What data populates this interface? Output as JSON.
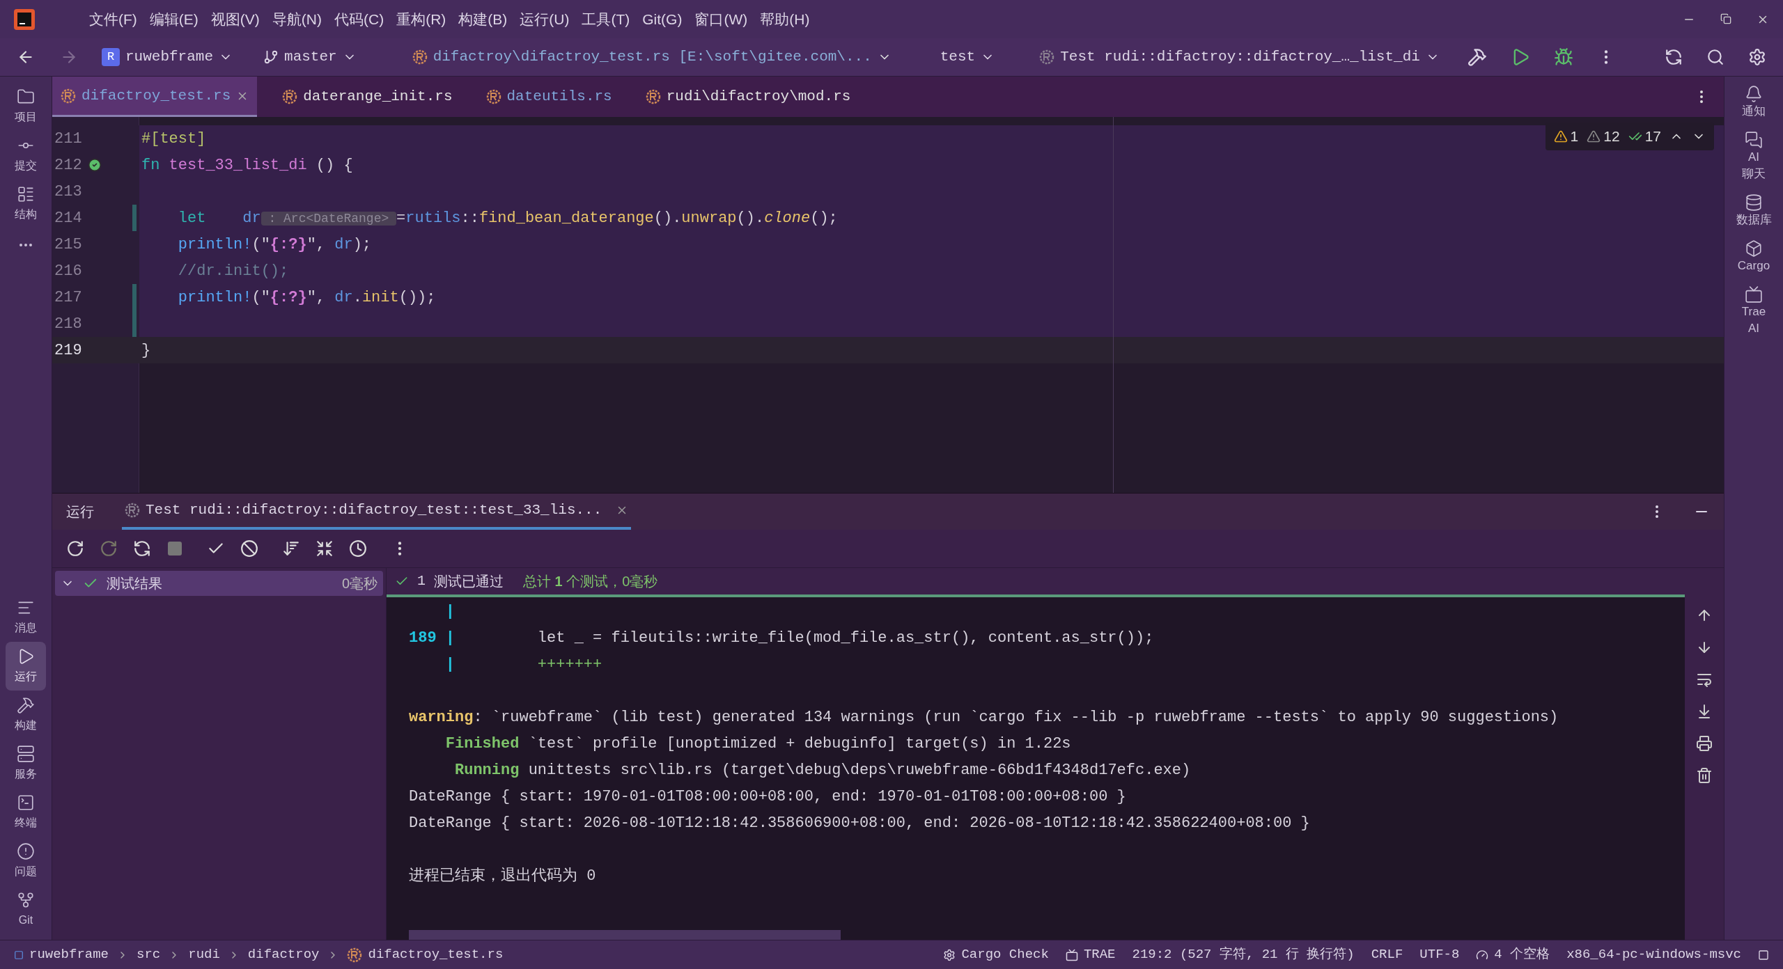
{
  "menu": [
    "文件(F)",
    "编辑(E)",
    "视图(V)",
    "导航(N)",
    "代码(C)",
    "重构(R)",
    "构建(B)",
    "运行(U)",
    "工具(T)",
    "Git(G)",
    "窗口(W)",
    "帮助(H)"
  ],
  "toolbar": {
    "project_badge": "R",
    "project": "ruwebframe",
    "branch": "master",
    "file": "difactroy\\difactroy_test.rs [E:\\soft\\gitee.com\\...",
    "profile": "test",
    "run_config": "Test rudi::difactroy::difactroy_…_list_di"
  },
  "tabs": [
    {
      "label": "difactroy_test.rs",
      "selected": true,
      "color": "#7fa6d9"
    },
    {
      "label": "daterange_init.rs",
      "selected": false,
      "color": "#e2e2e2"
    },
    {
      "label": "dateutils.rs",
      "selected": false,
      "color": "#7fa6d9"
    },
    {
      "label": "rudi\\difactroy\\mod.rs",
      "selected": false,
      "color": "#e2e2e2"
    }
  ],
  "left_tools_top": [
    {
      "label": "项目",
      "selected": false
    },
    {
      "label": "提交",
      "selected": false
    },
    {
      "label": "结构",
      "selected": false
    }
  ],
  "left_tools_bottom": [
    {
      "label": "消息",
      "selected": false
    },
    {
      "label": "运行",
      "selected": true
    },
    {
      "label": "构建",
      "selected": false
    },
    {
      "label": "服务",
      "selected": false
    },
    {
      "label": "终端",
      "selected": false
    },
    {
      "label": "问题",
      "selected": false
    },
    {
      "label": "Git",
      "selected": false
    }
  ],
  "right_tools": [
    "通知",
    "AI\n聊天",
    "数据库",
    "Cargo",
    "Trae\nAI"
  ],
  "inspections": {
    "warnings": "1",
    "weak_warnings": "12",
    "ok": "17"
  },
  "code": [
    {
      "number": "211",
      "current": false,
      "changed": false,
      "test_marker": false,
      "segments": [
        {
          "kind": "attr",
          "text": "#[test]"
        }
      ]
    },
    {
      "number": "212",
      "current": false,
      "changed": false,
      "test_marker": true,
      "segments": [
        {
          "kind": "kw",
          "text": "fn "
        },
        {
          "kind": "fn",
          "text": "test_33_list_di"
        },
        {
          "kind": "plain",
          "text": " () {"
        }
      ]
    },
    {
      "number": "213",
      "current": false,
      "changed": false,
      "test_marker": false
    },
    {
      "number": "214",
      "current": false,
      "changed": true,
      "test_marker": false,
      "segments": [
        {
          "kind": "kw",
          "text": "    let    "
        },
        {
          "kind": "var",
          "text": "dr"
        },
        {
          "kind": "hint",
          "text": " : Arc<DateRange> "
        },
        {
          "kind": "plain",
          "text": "="
        },
        {
          "kind": "var",
          "text": "rutils"
        },
        {
          "kind": "plain",
          "text": "::"
        },
        {
          "kind": "call",
          "text": "find_bean_daterange"
        },
        {
          "kind": "plain",
          "text": "()."
        },
        {
          "kind": "call",
          "text": "unwrap"
        },
        {
          "kind": "plain",
          "text": "()."
        },
        {
          "kind": "italic",
          "text": "clone"
        },
        {
          "kind": "plain",
          "text": "();"
        }
      ]
    },
    {
      "number": "215",
      "current": false,
      "changed": false,
      "test_marker": false,
      "segments": [
        {
          "kind": "macro",
          "text": "    println!"
        },
        {
          "kind": "plain",
          "text": "(\""
        },
        {
          "kind": "fmt",
          "text": "{:?}"
        },
        {
          "kind": "plain",
          "text": "\", "
        },
        {
          "kind": "var",
          "text": "dr"
        },
        {
          "kind": "plain",
          "text": ");"
        }
      ]
    },
    {
      "number": "216",
      "current": false,
      "changed": false,
      "test_marker": false,
      "segments": [
        {
          "kind": "comment",
          "text": "    //dr.init();"
        }
      ]
    },
    {
      "number": "217",
      "current": false,
      "changed": true,
      "test_marker": false,
      "segments": [
        {
          "kind": "macro",
          "text": "    println!"
        },
        {
          "kind": "plain",
          "text": "(\""
        },
        {
          "kind": "fmt",
          "text": "{:?}"
        },
        {
          "kind": "plain",
          "text": "\", "
        },
        {
          "kind": "var",
          "text": "dr"
        },
        {
          "kind": "plain",
          "text": "."
        },
        {
          "kind": "call",
          "text": "init"
        },
        {
          "kind": "plain",
          "text": "());"
        }
      ]
    },
    {
      "number": "218",
      "current": false,
      "changed": true,
      "test_marker": false
    },
    {
      "number": "219",
      "current": true,
      "changed": false,
      "test_marker": false,
      "segments": [
        {
          "kind": "plain",
          "text": "}"
        }
      ]
    }
  ],
  "run_panel": {
    "title": "运行",
    "tab": {
      "label": "Test rudi::difactroy::difactroy_test::test_33_lis...",
      "selected": true
    },
    "tree": [
      {
        "label": "测试结果",
        "duration": "0毫秒",
        "expanded": true,
        "passed": true
      }
    ],
    "summary_count": "1",
    "summary": "测试已通过",
    "detail": "总计 **1** 个测试，0毫秒",
    "output": [
      {
        "lines": [
          [
            {
              "kind": "gutter",
              "text": "    |"
            }
          ],
          [
            {
              "kind": "gutter",
              "text": "189 |"
            },
            {
              "kind": "plain",
              "text": "         let _ = fileutils::write_file(mod_file.as_str(), content.as_str());"
            }
          ],
          [
            {
              "kind": "gutter",
              "text": "    |"
            },
            {
              "kind": "added",
              "text": "         +++++++"
            }
          ]
        ]
      },
      {
        "lines": [
          [
            {
              "kind": "warn",
              "text": "warning"
            },
            {
              "kind": "plain",
              "text": ": `ruwebframe` (lib test) generated 134 warnings (run `cargo fix --lib -p ruwebframe --tests` to apply 90 suggestions)"
            }
          ],
          [
            {
              "kind": "ok",
              "text": "    Finished"
            },
            {
              "kind": "plain",
              "text": " `test` profile [unoptimized + debuginfo] target(s) in 1.22s"
            }
          ],
          [
            {
              "kind": "ok",
              "text": "     Running"
            },
            {
              "kind": "plain",
              "text": " unittests src\\lib.rs (target\\debug\\deps\\ruwebframe-66bd1f4348d17efc.exe)"
            }
          ],
          [
            {
              "kind": "plain",
              "text": "DateRange { start: 1970-01-01T08:00:00+08:00, end: 1970-01-01T08:00:00+08:00 }"
            }
          ],
          [
            {
              "kind": "plain",
              "text": "DateRange { start: 2026-08-10T12:18:42.358606900+08:00, end: 2026-08-10T12:18:42.358622400+08:00 }"
            }
          ]
        ]
      },
      {
        "lines": [
          [
            {
              "kind": "plain",
              "text": "进程已结束，退出代码为 0"
            }
          ]
        ]
      }
    ]
  },
  "status_bar": {
    "breadcrumbs": [
      "ruwebframe",
      "src",
      "rudi",
      "difactroy",
      "difactroy_test.rs"
    ],
    "items": [
      "Cargo Check",
      "TRAE",
      "219:2 (527 字符, 21 行 换行符)",
      "CRLF",
      "UTF-8",
      "4 个空格",
      "x86_64-pc-windows-msvc"
    ]
  }
}
